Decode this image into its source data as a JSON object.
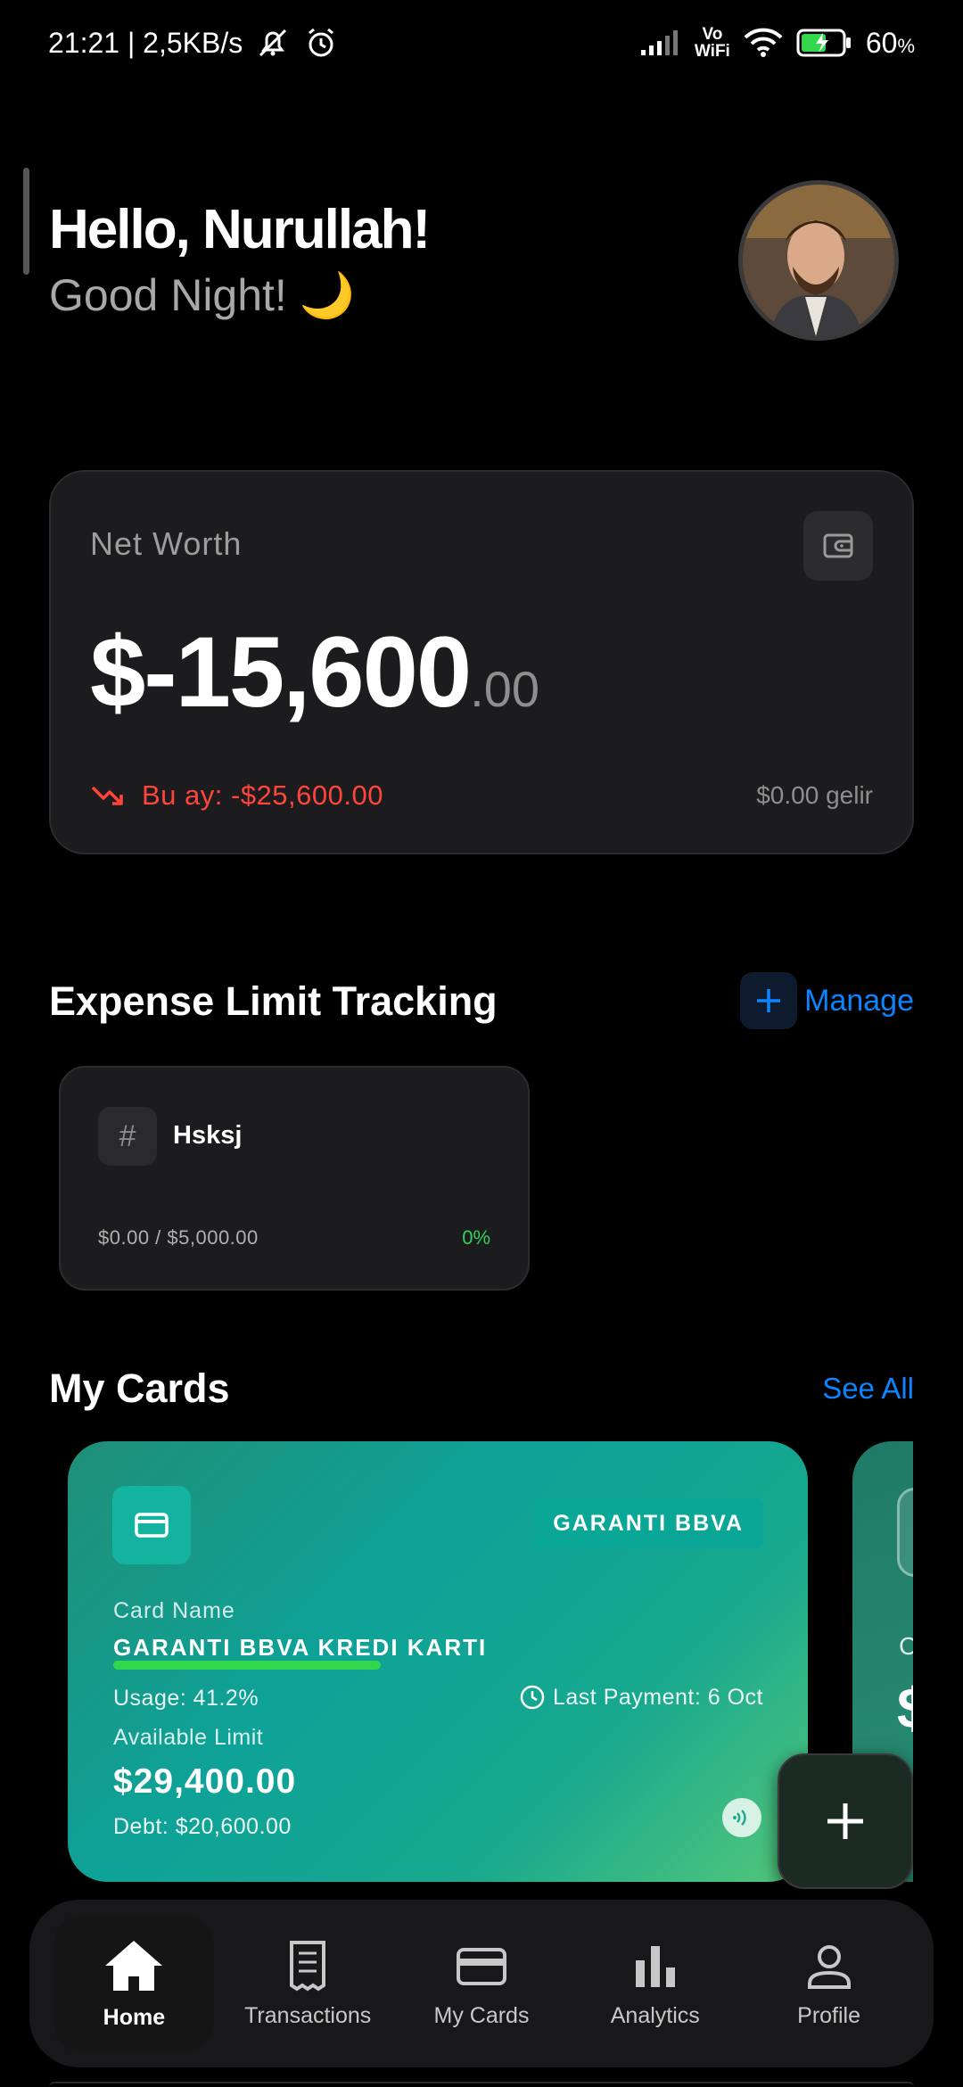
{
  "status_bar": {
    "time_speed": "21:21 | 2,5KB/s",
    "vo_wifi_top": "Vo",
    "vo_wifi_bottom": "WiFi",
    "battery": "60",
    "battery_pct_sign": "%"
  },
  "header": {
    "greeting": "Hello, Nurullah!",
    "subgreeting": "Good Night! 🌙"
  },
  "net_worth": {
    "label": "Net Worth",
    "amount_main": "$-15,600",
    "amount_cents": ".00",
    "trend_text": "Bu ay: -$25,600.00",
    "income_text": "$0.00 gelir",
    "colors": {
      "negative": "#ff453a",
      "muted": "#8e8e8e"
    }
  },
  "expense_limits": {
    "title": "Expense Limit Tracking",
    "manage_label": "Manage",
    "items": [
      {
        "icon": "#",
        "name": "Hsksj",
        "amount": "$0.00 / $5,000.00",
        "percent": "0%"
      }
    ]
  },
  "my_cards": {
    "title": "My Cards",
    "see_all": "See All",
    "cards": [
      {
        "bank": "GARANTI BBVA",
        "name_label": "Card Name",
        "name": "GARANTI BBVA KREDI KARTI",
        "usage_fraction": 0.412,
        "usage_text": "Usage: 41.2%",
        "last_payment": "Last Payment: 6 Oct",
        "available_label": "Available Limit",
        "available": "$29,400.00",
        "debt": "Debt: $20,600.00",
        "colors": {
          "gradient_start": "#1f8f78",
          "gradient_end": "#55c87a",
          "bar": "#32d74b"
        }
      }
    ],
    "next_card_peek": {
      "label_start": "C",
      "amount_start": "$"
    }
  },
  "fab": {
    "icon": "plus-icon"
  },
  "bottom_nav": {
    "items": [
      {
        "label": "Home",
        "icon": "home-icon",
        "active": true
      },
      {
        "label": "Transactions",
        "icon": "receipt-icon",
        "active": false
      },
      {
        "label": "My Cards",
        "icon": "card-icon",
        "active": false
      },
      {
        "label": "Analytics",
        "icon": "bar-chart-icon",
        "active": false
      },
      {
        "label": "Profile",
        "icon": "person-icon",
        "active": false
      }
    ]
  },
  "accent_color": "#0a84ff"
}
